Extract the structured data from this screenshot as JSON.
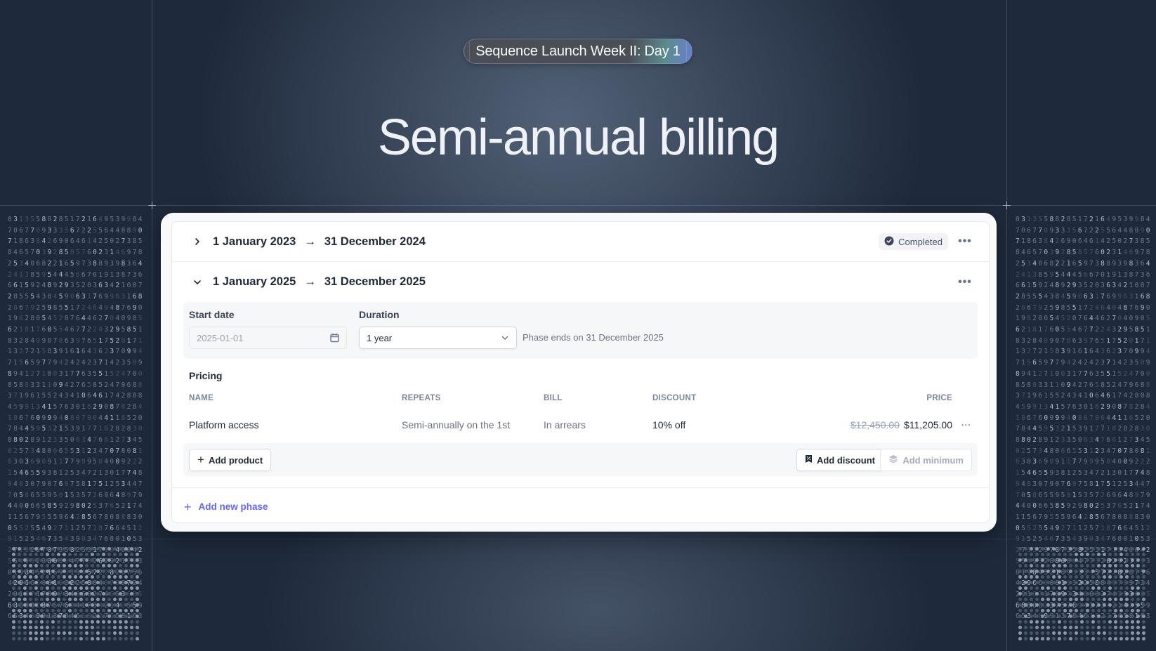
{
  "hero": {
    "badge_text": "Sequence Launch Week II: Day 1",
    "title": "Semi-annual billing"
  },
  "colors": {
    "background": "#1e293b",
    "accent_link": "#6366f1",
    "card": "#ffffff"
  },
  "phases": [
    {
      "expanded": false,
      "start": "1 January 2023",
      "arrow": "→",
      "end": "31 December 2024",
      "status": "Completed",
      "status_icon": "check-circle-icon",
      "chevron_icon": "chevron-right-icon",
      "more_icon": "ellipsis-icon"
    },
    {
      "expanded": true,
      "start": "1 January 2025",
      "arrow": "→",
      "end": "31 December 2025",
      "chevron_icon": "chevron-down-icon",
      "more_icon": "ellipsis-icon",
      "settings": {
        "start_date_label": "Start date",
        "start_date_value": "2025-01-01",
        "start_date_icon": "calendar-icon",
        "duration_label": "Duration",
        "duration_value": "1 year",
        "duration_icon": "chevron-down-icon",
        "phase_ends_text": "Phase ends on 31 December 2025"
      },
      "pricing": {
        "label": "Pricing",
        "columns": [
          "NAME",
          "REPEATS",
          "BILL",
          "DISCOUNT",
          "PRICE"
        ],
        "rows": [
          {
            "name": "Platform access",
            "repeats": "Semi-annually on the 1st",
            "bill": "In arrears",
            "discount": "10% off",
            "original_price": "$12,450.00",
            "price": "$11,205.00"
          }
        ]
      },
      "actions": {
        "add_product": "Add product",
        "add_discount": "Add discount",
        "add_minimum": "Add minimum"
      }
    }
  ],
  "add_new_phase": "Add new phase",
  "decor": {
    "digit_rows": [
      "031355882851721649539984",
      "706770933356722556448890",
      "718638426906461425027385",
      "846570392858576023146978",
      "253406822165973889398364",
      "241385954445667019138736",
      "661592489293520363421007",
      "285554384590631769963168",
      "286792598551724640487690",
      "198280545207644627040905",
      "621817605546772243295851",
      "832840907863976517520171",
      "132721583916164362370994",
      "715659779424242371423509",
      "894127100317763551524700",
      "858833110942765852479688",
      "371961552434106461742808",
      "459913415763016290878284",
      "186760999408079644116520",
      "784459532153917718282830",
      "880289123350634766127345",
      "025734806655312347078081",
      "830369091177999504009222",
      "154655938125347213017748",
      "948307907697581751253447",
      "705865595015357269648979",
      "440066585929802537652174",
      "115679555964285678088830",
      "055255492711257187664512",
      "915254673543903476801053",
      "271329707358253171840042",
      "554932880004773262921793",
      "019845216931345722826756",
      "429666081932258840799724",
      "291071709734860274553685",
      "688082375769417342142559",
      "653489913784618227658163"
    ]
  }
}
